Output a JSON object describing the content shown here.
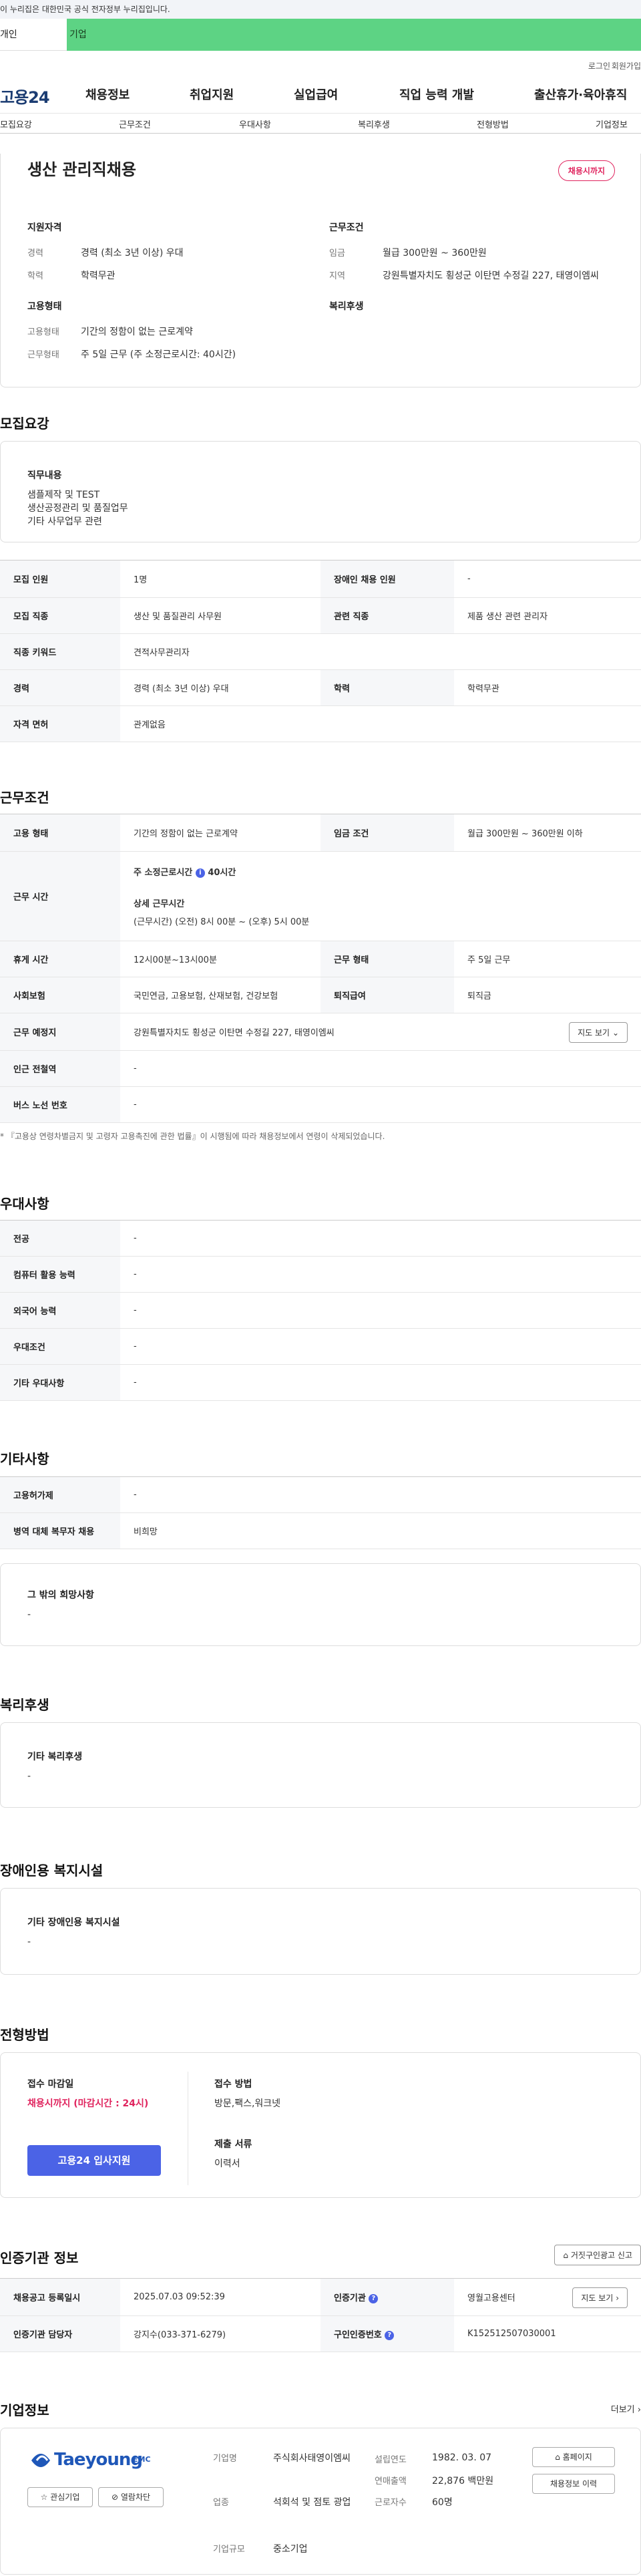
{
  "gov_banner": "이 누리집은 대한민국 공식 전자정부 누리집입니다.",
  "top_tabs": {
    "personal": "개인",
    "corporate": "기업"
  },
  "util": {
    "login": "로그인",
    "join": "회원가입"
  },
  "logo": "고용24",
  "gnb": [
    "채용정보",
    "취업지원",
    "실업급여",
    "직업 능력 개발",
    "출산휴가·육아휴직"
  ],
  "subnav": [
    "모집요강",
    "근무조건",
    "우대사항",
    "복리후생",
    "전형방법",
    "기업정보"
  ],
  "summary": {
    "title": "생산 관리직채용",
    "badge": "채용시까지",
    "qual_heading": "지원자격",
    "career_k": "경력",
    "career_v": "경력 (최소 3년 이상) 우대",
    "edu_k": "학력",
    "edu_v": "학력무관",
    "cond_heading": "근무조건",
    "wage_k": "임금",
    "wage_v": "월급 300만원 ~ 360만원",
    "region_k": "지역",
    "region_v": "강원특별자치도 횡성군 이탄면 수정길 227, 태영이엠씨",
    "emp_heading": "고용형태",
    "emp_k": "고용형태",
    "emp_v": "기간의 정함이 없는 근로계약",
    "work_k": "근무형태",
    "work_v": "주 5일 근무 (주 소정근로시간: 40시간)",
    "welfare_heading": "복리후생"
  },
  "recruit": {
    "section": "모집요강",
    "duty_heading": "직무내용",
    "duty_lines": [
      "샘플제작 및 TEST",
      "생산공정관리 및 품질업무",
      "기타 사무업무 관련"
    ],
    "rows": {
      "count_k": "모집 인원",
      "count_v": "1명",
      "disabled_k": "장애인 채용 인원",
      "disabled_v": "-",
      "job_k": "모집 직종",
      "job_v": "생산 및 품질관리 사무원",
      "related_k": "관련 직종",
      "related_v": "제품 생산 관련 관리자",
      "keyword_k": "직종 키워드",
      "keyword_v": "견적사무관리자",
      "career_k": "경력",
      "career_v": "경력 (최소 3년 이상) 우대",
      "edu_k": "학력",
      "edu_v": "학력무관",
      "license_k": "자격 면허",
      "license_v": "관계없음"
    }
  },
  "conditions": {
    "section": "근무조건",
    "emp_k": "고용 형태",
    "emp_v": "기간의 정함이 없는 근로계약",
    "wage_k": "임금 조건",
    "wage_v": "월급 300만원 ~ 360만원 이하",
    "hours_k": "근무 시간",
    "hours_weekly_label": "주 소정근로시간",
    "hours_weekly_value": "40시간",
    "hours_detail_label": "상세 근무시간",
    "hours_detail_value": "(근무시간) (오전) 8시 00분 ~ (오후) 5시 00분",
    "break_k": "휴게 시간",
    "break_v": "12시00분~13시00분",
    "shift_k": "근무 형태",
    "shift_v": "주 5일 근무",
    "insurance_k": "사회보험",
    "insurance_v": "국민연금, 고용보험, 산재보험, 건강보험",
    "severance_k": "퇴직급여",
    "severance_v": "퇴직금",
    "place_k": "근무 예정지",
    "place_v": "강원특별자치도 횡성군 이탄면 수정길 227, 태영이엠씨",
    "map_btn": "지도 보기",
    "station_k": "인근 전철역",
    "station_v": "-",
    "bus_k": "버스 노선 번호",
    "bus_v": "-",
    "note": "* 『고용상 연령차별금지 및 고령자 고용촉진에 관한 법률』이 시행됨에 따라 채용정보에서 연령이 삭제되었습니다."
  },
  "preference": {
    "section": "우대사항",
    "rows": [
      {
        "k": "전공",
        "v": "-"
      },
      {
        "k": "컴퓨터 활용 능력",
        "v": "-"
      },
      {
        "k": "외국어 능력",
        "v": "-"
      },
      {
        "k": "우대조건",
        "v": "-"
      },
      {
        "k": "기타 우대사항",
        "v": "-"
      }
    ]
  },
  "other": {
    "section": "기타사항",
    "rows": [
      {
        "k": "고용허가제",
        "v": "-"
      },
      {
        "k": "병역 대체 복무자 채용",
        "v": "비희망"
      }
    ],
    "misc_heading": "그 밖의 희망사항",
    "misc_value": "-"
  },
  "welfare": {
    "section": "복리후생",
    "heading": "기타 복리후생",
    "value": "-"
  },
  "disability": {
    "section": "장애인용 복지시설",
    "heading": "기타 장애인용 복지시설",
    "value": "-"
  },
  "selection": {
    "section": "전형방법",
    "deadline_k": "접수 마감일",
    "deadline_v": "채용시까지 (마감시간 : 24시)",
    "apply_btn": "고용24 입사지원",
    "method_k": "접수 방법",
    "method_v": "방문,팩스,워크넷",
    "docs_k": "제출 서류",
    "docs_v": "이력서"
  },
  "cert": {
    "section": "인증기관 정보",
    "report_btn": "거짓구인광고 신고",
    "reg_k": "채용공고 등록일시",
    "reg_v": "2025.07.03 09:52:39",
    "agency_k": "인증기관",
    "agency_v": "영월고용센터",
    "map_btn": "지도 보기",
    "manager_k": "인증기관 담당자",
    "manager_v": "강지수(033-371-6279)",
    "number_k": "구인인증번호",
    "number_v": "K152512507030001"
  },
  "company": {
    "section": "기업정보",
    "more": "더보기",
    "logo_text": "Taeyoung",
    "logo_suffix": "EMC",
    "fav_btn": "관심기업",
    "block_btn": "열람차단",
    "name_k": "기업명",
    "name_v": "주식회사태영이엠씨",
    "industry_k": "업종",
    "industry_v": "석회석 및 점토 광업",
    "scale_k": "기업규모",
    "scale_v": "중소기업",
    "founded_k": "설립연도",
    "founded_v": "1982. 03. 07",
    "revenue_k": "연매출액",
    "revenue_v": "22,876 백만원",
    "staff_k": "근로자수",
    "staff_v": "60명",
    "homepage_btn": "홈페이지",
    "history_btn": "채용정보 이력"
  },
  "colors": {
    "accent": "#4b63e6",
    "red": "#e0245e",
    "corp_tab": "#5dd384",
    "navy": "#1b3c72"
  }
}
